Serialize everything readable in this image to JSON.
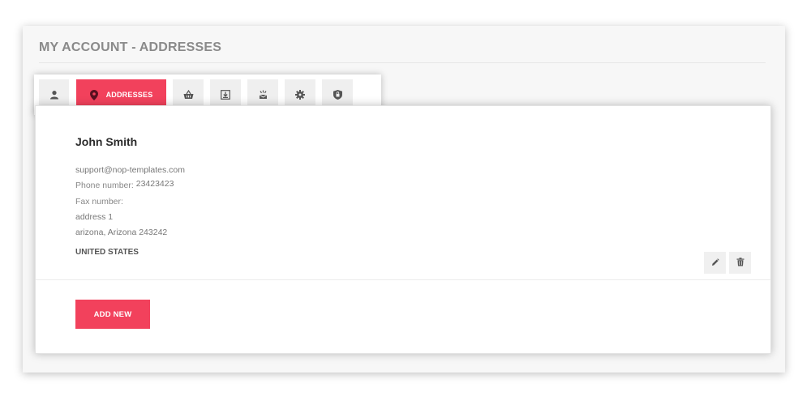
{
  "page": {
    "title": "MY ACCOUNT - ADDRESSES"
  },
  "tabs": [
    {
      "id": "info",
      "icon": "user-icon",
      "label": ""
    },
    {
      "id": "addresses",
      "icon": "map-pin-icon",
      "label": "ADDRESSES",
      "active": true
    },
    {
      "id": "orders",
      "icon": "basket-icon",
      "label": ""
    },
    {
      "id": "downloads",
      "icon": "download-icon",
      "label": ""
    },
    {
      "id": "subscriptions",
      "icon": "subscriptions-icon",
      "label": ""
    },
    {
      "id": "settings",
      "icon": "gear-icon",
      "label": ""
    },
    {
      "id": "security",
      "icon": "shield-icon",
      "label": ""
    }
  ],
  "address": {
    "name": "John Smith",
    "email": "support@nop-templates.com",
    "phone_label": "Phone number:",
    "phone_value": "23423423",
    "fax_label": "Fax number:",
    "fax_value": "",
    "address1": "address 1",
    "city_line": "arizona, Arizona 243242",
    "country": "UNITED STATES"
  },
  "actions": {
    "edit_icon": "pencil-icon",
    "delete_icon": "trash-icon"
  },
  "buttons": {
    "add_new": "ADD NEW"
  },
  "colors": {
    "accent": "#f2415c",
    "tab_bg": "#efefef",
    "icon": "#555555"
  }
}
